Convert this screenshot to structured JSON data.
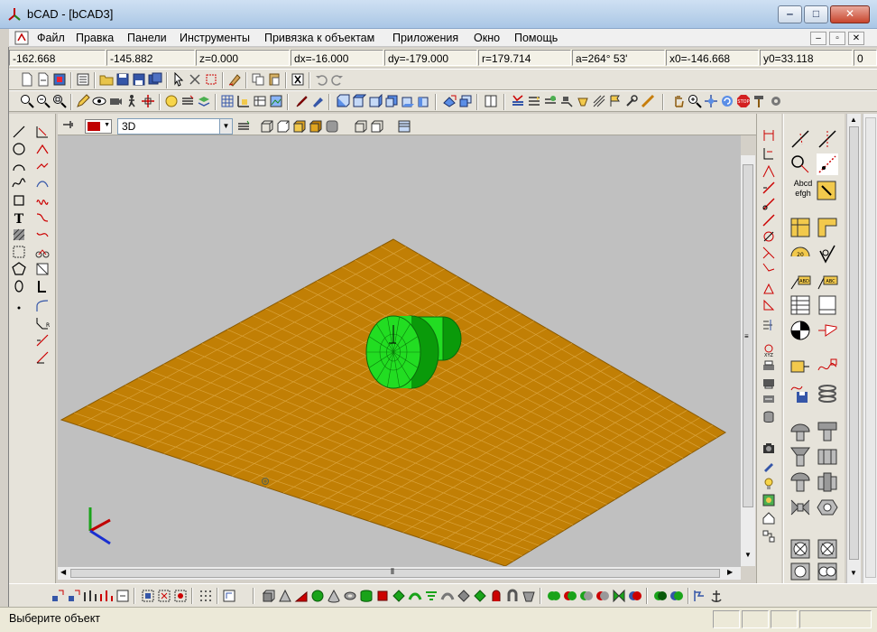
{
  "window": {
    "title": "bCAD - [bCAD3]"
  },
  "menu": {
    "items": [
      "Файл",
      "Правка",
      "Панели",
      "Инструменты",
      "Привязка к объектам",
      "Приложения",
      "Окно",
      "Помощь"
    ]
  },
  "coords": {
    "x": "-162.668",
    "y": "-145.882",
    "z": "z=0.000",
    "dx": "dx=-16.000",
    "dy": "dy=-179.000",
    "r": "r=179.714",
    "a": "a=264° 53'",
    "x0": "x0=-146.668",
    "y0": "y0=33.118",
    "extra": "0"
  },
  "view": {
    "mode": "3D",
    "color": "#c00000"
  },
  "palette_labels": {
    "text_sample": "Abcd\nefgh",
    "abd": "ABD",
    "abc": "ABC"
  },
  "status": {
    "message": "Выберите объект"
  },
  "colors": {
    "floor": "#c17f05",
    "floor_grid": "#d9a23a",
    "model": "#22dd22",
    "model_dark": "#0a9a0a",
    "viewport_bg": "#c0c0c0"
  }
}
